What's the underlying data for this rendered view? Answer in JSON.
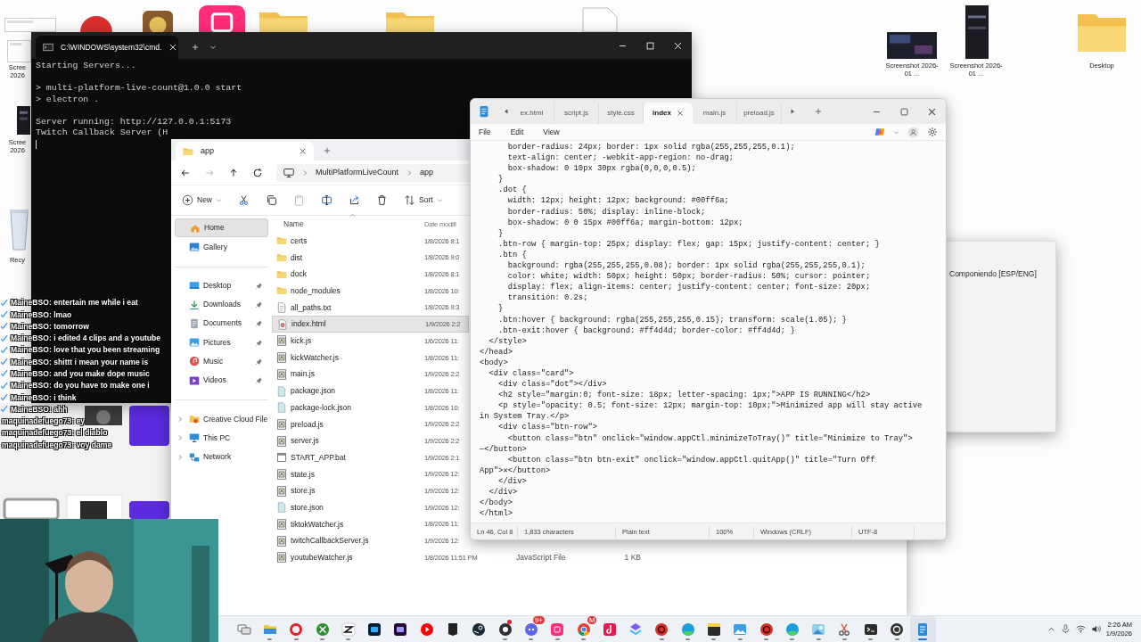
{
  "desktop": {
    "top_icons": [
      {
        "kind": "thumbnail"
      },
      {
        "kind": "red-app"
      },
      {
        "kind": "game"
      },
      {
        "kind": "pink-app"
      },
      {
        "kind": "folder"
      },
      {
        "kind": "folder"
      },
      {
        "kind": "document"
      }
    ],
    "left_icons": [
      {
        "kind": "thumbnail",
        "label": "Scree 2026"
      },
      {
        "kind": "phone-shot",
        "label": "Scree 2026"
      },
      {
        "kind": "recycle",
        "label": "Recy"
      }
    ],
    "right_icons": [
      {
        "kind": "screenshot",
        "label": "Screenshot 2026-01 ..."
      },
      {
        "kind": "phone-shot",
        "label": "Screenshot 2026-01 ..."
      },
      {
        "kind": "folder",
        "label": "Desktop"
      }
    ]
  },
  "side_window": {
    "text": "Componiendo [ESP/ENG]"
  },
  "terminal": {
    "tab_title": "C:\\WINDOWS\\system32\\cmd.",
    "blocks": [
      [
        "Starting Servers..."
      ],
      [
        "> multi-platform-live-count@1.0.0 start",
        "> electron ."
      ],
      [
        "Server running: http://127.0.0.1:5173",
        "Twitch Callback Server (H"
      ]
    ]
  },
  "explorer": {
    "tab": {
      "title": "app"
    },
    "path": [
      "MultiPlatformLiveCount",
      "app"
    ],
    "commands": [
      {
        "kind": "new",
        "label": "New",
        "disabled": false
      },
      {
        "kind": "cut",
        "disabled": false
      },
      {
        "kind": "copy",
        "disabled": false
      },
      {
        "kind": "paste",
        "disabled": true
      },
      {
        "kind": "rename",
        "disabled": false
      },
      {
        "kind": "share",
        "disabled": false
      },
      {
        "kind": "delete",
        "disabled": false
      },
      {
        "kind": "sort",
        "label": "Sort",
        "disabled": false
      }
    ],
    "sidebar": {
      "groups": [
        {
          "items": [
            {
              "label": "Home",
              "kind": "home",
              "selected": true
            },
            {
              "label": "Gallery",
              "kind": "gallery",
              "selected": false
            }
          ]
        },
        {
          "items": [
            {
              "label": "Desktop",
              "kind": "desktop",
              "selected": false,
              "pinned": true
            },
            {
              "label": "Downloads",
              "kind": "downloads",
              "selected": false,
              "pinned": true
            },
            {
              "label": "Documents",
              "kind": "documents",
              "selected": false,
              "pinned": true
            },
            {
              "label": "Pictures",
              "kind": "pictures",
              "selected": false,
              "pinned": true
            },
            {
              "label": "Music",
              "kind": "music",
              "selected": false,
              "pinned": true
            },
            {
              "label": "Videos",
              "kind": "videos",
              "selected": false,
              "pinned": true
            }
          ]
        },
        {
          "items": [
            {
              "label": "Creative Cloud File",
              "kind": "cloud",
              "selected": false,
              "expanded": false
            },
            {
              "label": "This PC",
              "kind": "pc",
              "selected": false,
              "expanded": false
            },
            {
              "label": "Network",
              "kind": "network",
              "selected": false,
              "expanded": false
            }
          ]
        }
      ]
    },
    "columns": [
      {
        "label": "Name",
        "sorted": true
      },
      {
        "label": "Date modifi",
        "sorted": false
      }
    ],
    "files": [
      {
        "name": "certs",
        "kind": "folder",
        "date": "1/8/2026 8:1",
        "selected": false
      },
      {
        "name": "dist",
        "kind": "folder",
        "date": "1/8/2026 9:0",
        "selected": false
      },
      {
        "name": "dock",
        "kind": "folder",
        "date": "1/8/2026 8:1",
        "selected": false
      },
      {
        "name": "node_modules",
        "kind": "folder",
        "date": "1/8/2026 10:",
        "selected": false
      },
      {
        "name": "all_paths.txt",
        "kind": "text",
        "date": "1/8/2026 9:3",
        "selected": false
      },
      {
        "name": "index.html",
        "kind": "html",
        "date": "1/9/2026 2:2",
        "selected": true
      },
      {
        "name": "kick.js",
        "kind": "js",
        "date": "1/6/2026 11:",
        "selected": false
      },
      {
        "name": "kickWatcher.js",
        "kind": "js",
        "date": "1/8/2026 11:",
        "selected": false
      },
      {
        "name": "main.js",
        "kind": "js",
        "date": "1/9/2026 2:2",
        "selected": false
      },
      {
        "name": "package.json",
        "kind": "json",
        "date": "1/8/2026 11:",
        "selected": false
      },
      {
        "name": "package-lock.json",
        "kind": "json",
        "date": "1/8/2026 10:",
        "selected": false
      },
      {
        "name": "preload.js",
        "kind": "js",
        "date": "1/9/2026 2:2",
        "selected": false
      },
      {
        "name": "server.js",
        "kind": "js",
        "date": "1/9/2026 2:2",
        "selected": false
      },
      {
        "name": "START_APP.bat",
        "kind": "bat",
        "date": "1/9/2026 2:1",
        "selected": false
      },
      {
        "name": "state.js",
        "kind": "js",
        "date": "1/9/2026 12:",
        "selected": false
      },
      {
        "name": "store.js",
        "kind": "js",
        "date": "1/9/2026 12:",
        "selected": false
      },
      {
        "name": "store.json",
        "kind": "json",
        "date": "1/9/2026 12:",
        "selected": false
      },
      {
        "name": "tiktokWatcher.js",
        "kind": "js",
        "date": "1/8/2026 11:",
        "selected": false
      },
      {
        "name": "twitchCallbackServer.js",
        "kind": "js",
        "date": "1/9/2026 12:",
        "selected": false
      },
      {
        "name": "youtubeWatcher.js",
        "kind": "js",
        "date": "1/8/2026 11:51 PM",
        "type": "JavaScript File",
        "size": "1 KB",
        "selected": false
      }
    ]
  },
  "notepad": {
    "tabs": [
      {
        "label": "ex.html",
        "selected": false
      },
      {
        "label": "script.js",
        "selected": false
      },
      {
        "label": "style.css",
        "selected": false
      },
      {
        "label": "index",
        "selected": true
      },
      {
        "label": "main.js",
        "selected": false
      },
      {
        "label": "preload.js",
        "selected": false
      }
    ],
    "menu": [
      "File",
      "Edit",
      "View"
    ],
    "lines": [
      "      border-radius: 24px; border: 1px solid rgba(255,255,255,0.1);",
      "      text-align: center; -webkit-app-region: no-drag;",
      "      box-shadow: 0 10px 30px rgba(0,0,0,0.5);",
      "    }",
      "    .dot {",
      "      width: 12px; height: 12px; background: #00ff6a;",
      "      border-radius: 50%; display: inline-block;",
      "      box-shadow: 0 0 15px #00ff6a; margin-bottom: 12px;",
      "    }",
      "    .btn-row { margin-top: 25px; display: flex; gap: 15px; justify-content: center; }",
      "    .btn {",
      "      background: rgba(255,255,255,0.08); border: 1px solid rgba(255,255,255,0.1);",
      "      color: white; width: 50px; height: 50px; border-radius: 50%; cursor: pointer;",
      "      display: flex; align-items: center; justify-content: center; font-size: 20px;",
      "      transition: 0.2s;",
      "    }",
      "    .btn:hover { background: rgba(255,255,255,0.15); transform: scale(1.05); }",
      "    .btn-exit:hover { background: #ff4d4d; border-color: #ff4d4d; }",
      "  </style>",
      "</head>",
      "<body>",
      "  <div class=\"card\">",
      "    <div class=\"dot\"></div>",
      "    <h2 style=\"margin:0; font-size: 18px; letter-spacing: 1px;\">APP IS RUNNING</h2>",
      "    <p style=\"opacity: 0.5; font-size: 12px; margin-top: 10px;\">Minimized app will stay active",
      "in System Tray.</p>",
      "    <div class=\"btn-row\">",
      "      <button class=\"btn\" onclick=\"window.appCtl.minimizeToTray()\" title=\"Minimize to Tray\">",
      "—</button>",
      "      <button class=\"btn btn-exit\" onclick=\"window.appCtl.quitApp()\" title=\"Turn Off",
      "App\">✕</button>",
      "    </div>",
      "  </div>",
      "</body>",
      "</html>"
    ],
    "status": [
      "Ln 46, Col 8",
      "1,833 characters",
      "Plain text",
      "100%",
      "Windows (CRLF)",
      "UTF-8"
    ]
  },
  "chat": [
    {
      "line": "**MaineBSO**: entertain me while i eat",
      "verified": true
    },
    {
      "line": "**MaineBSO**: lmao",
      "verified": true
    },
    {
      "line": "**MaineBSO**: tomorrow",
      "verified": true
    },
    {
      "line": "**MaineBSO**: i edited 4 clips and a youtube",
      "verified": true
    },
    {
      "line": "**MaineBSO**: love that you been streaming",
      "verified": true
    },
    {
      "line": "**MaineBSO**: shittt i mean your name is",
      "verified": true
    },
    {
      "line": "**MaineBSO**: and you make dope music",
      "verified": true
    },
    {
      "line": "**MaineBSO**: do you have to make one i",
      "verified": true
    },
    {
      "line": "**MaineBSO**: i think",
      "verified": true
    },
    {
      "line": "**MaineBSO**: ahh",
      "verified": true
    },
    {
      "line": "**maquinadefuego73**: ey",
      "verified": false
    },
    {
      "line": "**maquinadefuego73**: el diablo",
      "verified": false
    },
    {
      "line": "**maquinadefuego73**: voy dame",
      "verified": false
    }
  ],
  "taskbar": {
    "apps": [
      {
        "kind": "task-view",
        "running": false,
        "active": false,
        "alert": false
      },
      {
        "kind": "folder",
        "running": true,
        "active": false,
        "alert": false
      },
      {
        "kind": "ring",
        "running": true,
        "active": false,
        "alert": false
      },
      {
        "kind": "cross",
        "running": true,
        "active": false,
        "alert": false
      },
      {
        "kind": "zigzag",
        "running": true,
        "active": false,
        "alert": false
      },
      {
        "kind": "ps",
        "running": false,
        "active": false,
        "alert": false
      },
      {
        "kind": "pr",
        "running": false,
        "active": false,
        "alert": false
      },
      {
        "kind": "play",
        "running": false,
        "active": false,
        "alert": false
      },
      {
        "kind": "shield",
        "running": false,
        "active": false,
        "alert": false
      },
      {
        "kind": "steam",
        "running": false,
        "active": false,
        "alert": false
      },
      {
        "kind": "record",
        "running": true,
        "active": false,
        "alert": true
      },
      {
        "kind": "chat",
        "running": true,
        "active": false,
        "alert": false,
        "badge": "9+"
      },
      {
        "kind": "pink",
        "running": true,
        "active": false,
        "alert": false
      },
      {
        "kind": "browser",
        "running": true,
        "active": false,
        "alert": false,
        "badge": "M"
      },
      {
        "kind": "note",
        "running": false,
        "active": false,
        "alert": false
      },
      {
        "kind": "stack",
        "running": false,
        "active": false,
        "alert": false
      },
      {
        "kind": "co",
        "running": true,
        "active": false,
        "alert": false
      },
      {
        "kind": "wave",
        "running": true,
        "active": false,
        "alert": false
      },
      {
        "kind": "sticky",
        "running": true,
        "active": false,
        "alert": false
      },
      {
        "kind": "photos",
        "running": true,
        "active": false,
        "alert": false
      },
      {
        "kind": "co",
        "running": true,
        "active": false,
        "alert": false
      },
      {
        "kind": "wave",
        "running": true,
        "active": false,
        "alert": false
      },
      {
        "kind": "landscape",
        "running": true,
        "active": false,
        "alert": false
      },
      {
        "kind": "snip",
        "running": true,
        "active": false,
        "alert": false
      },
      {
        "kind": "terminal",
        "running": true,
        "active": false,
        "alert": false
      },
      {
        "kind": "knot",
        "running": true,
        "active": false,
        "alert": false
      },
      {
        "kind": "notepad",
        "running": true,
        "active": true,
        "alert": false
      }
    ],
    "clock": {
      "time": "2:26 AM",
      "date": "1/9/2026"
    }
  }
}
